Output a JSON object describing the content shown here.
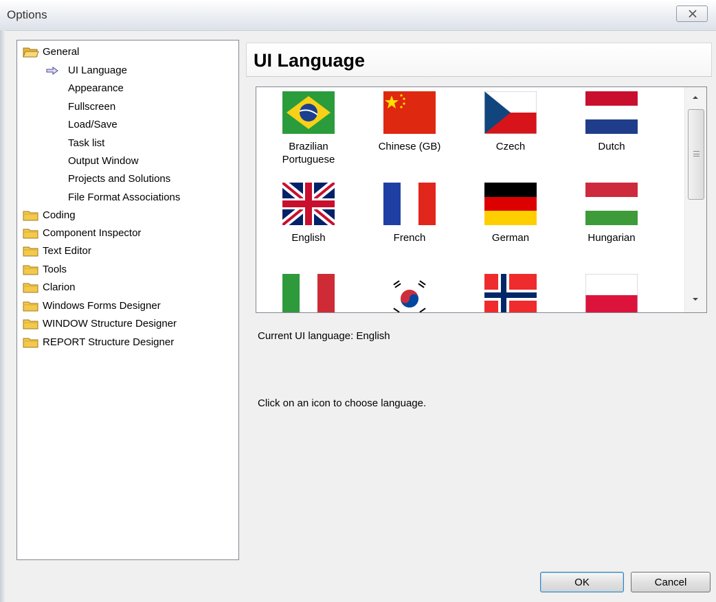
{
  "window": {
    "title": "Options"
  },
  "tree": {
    "items": [
      {
        "label": "General",
        "icon": "folder-open-icon"
      },
      {
        "label": "UI Language",
        "icon": "arrow-right-icon"
      },
      {
        "label": "Appearance"
      },
      {
        "label": "Fullscreen"
      },
      {
        "label": "Load/Save"
      },
      {
        "label": "Task list"
      },
      {
        "label": "Output Window"
      },
      {
        "label": "Projects and Solutions"
      },
      {
        "label": "File Format Associations"
      },
      {
        "label": "Coding",
        "icon": "folder-icon"
      },
      {
        "label": "Component Inspector",
        "icon": "folder-icon"
      },
      {
        "label": "Text Editor",
        "icon": "folder-icon"
      },
      {
        "label": "Tools",
        "icon": "folder-icon"
      },
      {
        "label": "Clarion",
        "icon": "folder-icon"
      },
      {
        "label": "Windows Forms Designer",
        "icon": "folder-icon"
      },
      {
        "label": "WINDOW Structure Designer",
        "icon": "folder-icon"
      },
      {
        "label": "REPORT Structure Designer",
        "icon": "folder-icon"
      }
    ],
    "selected": "UI Language"
  },
  "panel": {
    "title": "UI Language",
    "languages": [
      {
        "name": "Brazilian Portuguese",
        "flag": "brazil-flag-icon"
      },
      {
        "name": "Chinese (GB)",
        "flag": "china-flag-icon"
      },
      {
        "name": "Czech",
        "flag": "czech-flag-icon"
      },
      {
        "name": "Dutch",
        "flag": "netherlands-flag-icon"
      },
      {
        "name": "English",
        "flag": "uk-flag-icon"
      },
      {
        "name": "French",
        "flag": "france-flag-icon"
      },
      {
        "name": "German",
        "flag": "germany-flag-icon"
      },
      {
        "name": "Hungarian",
        "flag": "hungary-flag-icon"
      },
      {
        "name": "",
        "flag": "italy-flag-icon"
      },
      {
        "name": "",
        "flag": "korea-flag-icon"
      },
      {
        "name": "",
        "flag": "norway-flag-icon"
      },
      {
        "name": "",
        "flag": "poland-flag-icon"
      }
    ],
    "current_language": "Current UI language: English",
    "instruction": "Click on an icon to choose language."
  },
  "buttons": {
    "ok": "OK",
    "cancel": "Cancel"
  },
  "colors": {
    "accent": "#3c7fb1",
    "folder": "#f2c94c"
  }
}
